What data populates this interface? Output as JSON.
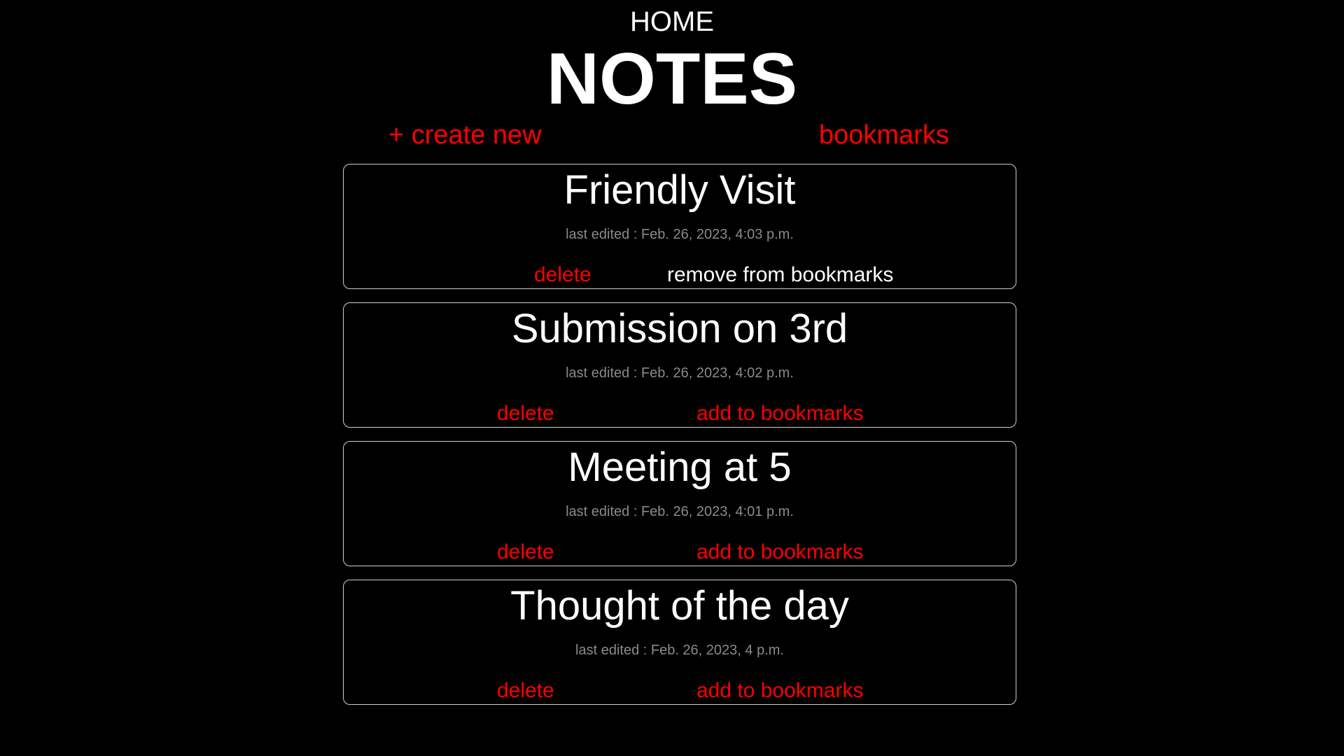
{
  "header": {
    "home_label": "HOME",
    "title": "NOTES"
  },
  "actions": {
    "create_label": "+ create new",
    "bookmarks_label": "bookmarks"
  },
  "notes": [
    {
      "title": "Friendly Visit",
      "edited": "last edited : Feb. 26, 2023, 4:03 p.m.",
      "delete_label": "delete",
      "bookmark_label": "remove from bookmarks",
      "bookmarked": true
    },
    {
      "title": "Submission on 3rd",
      "edited": "last edited : Feb. 26, 2023, 4:02 p.m.",
      "delete_label": "delete",
      "bookmark_label": "add to bookmarks",
      "bookmarked": false
    },
    {
      "title": "Meeting at 5",
      "edited": "last edited : Feb. 26, 2023, 4:01 p.m.",
      "delete_label": "delete",
      "bookmark_label": "add to bookmarks",
      "bookmarked": false
    },
    {
      "title": "Thought of the day",
      "edited": "last edited : Feb. 26, 2023, 4 p.m.",
      "delete_label": "delete",
      "bookmark_label": "add to bookmarks",
      "bookmarked": false
    }
  ],
  "colors": {
    "background": "#000000",
    "accent": "#ff0000",
    "text": "#ffffff",
    "muted": "#8a8a8a"
  }
}
